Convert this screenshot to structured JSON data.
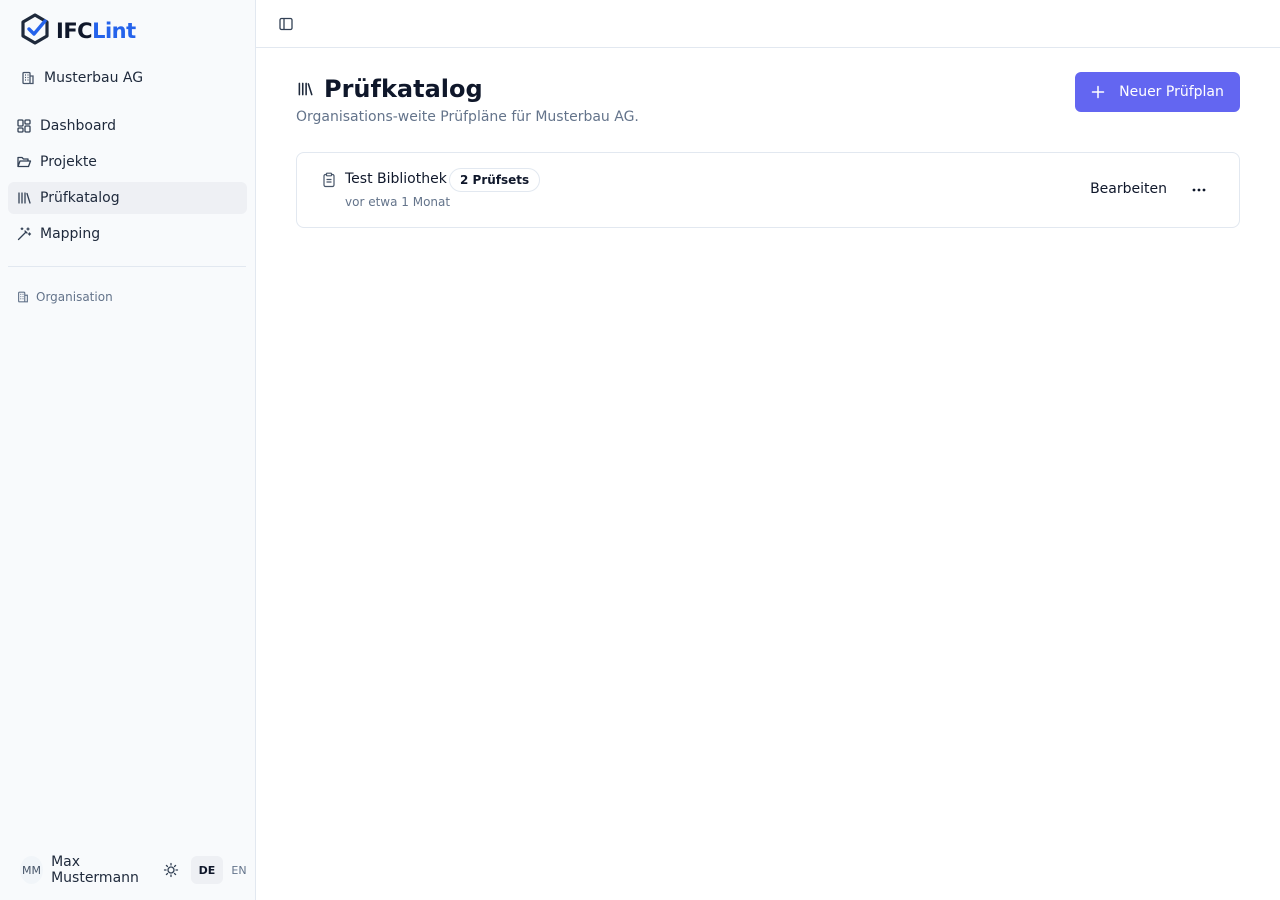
{
  "brand": {
    "name_part1": "IFC",
    "name_part2": "Lint",
    "accent": "#2563eb",
    "logo_icon": "hexagon-check-icon"
  },
  "sidebar": {
    "organization": {
      "name": "Musterbau AG",
      "icon": "building-icon"
    },
    "nav": [
      {
        "label": "Dashboard",
        "icon": "dashboard-icon",
        "active": false
      },
      {
        "label": "Projekte",
        "icon": "folder-open-icon",
        "active": false
      },
      {
        "label": "Prüfkatalog",
        "icon": "library-icon",
        "active": true
      },
      {
        "label": "Mapping",
        "icon": "wand-icon",
        "active": false
      }
    ],
    "section_label": "Organisation",
    "user": {
      "initials": "MM",
      "name": "Max Mustermann"
    },
    "languages": [
      {
        "code": "DE",
        "active": true
      },
      {
        "code": "EN",
        "active": false
      }
    ]
  },
  "topbar": {
    "toggle_icon": "panel-left-icon"
  },
  "main": {
    "title": "Prüfkatalog",
    "subtitle": "Organisations-weite Prüfpläne für Musterbau AG.",
    "new_button_label": "Neuer Prüfplan",
    "primary_color": "#6366f1",
    "items": [
      {
        "title": "Test Bibliothek",
        "badge": "2 Prüfsets",
        "meta": "vor etwa 1 Monat",
        "edit_label": "Bearbeiten"
      }
    ]
  }
}
